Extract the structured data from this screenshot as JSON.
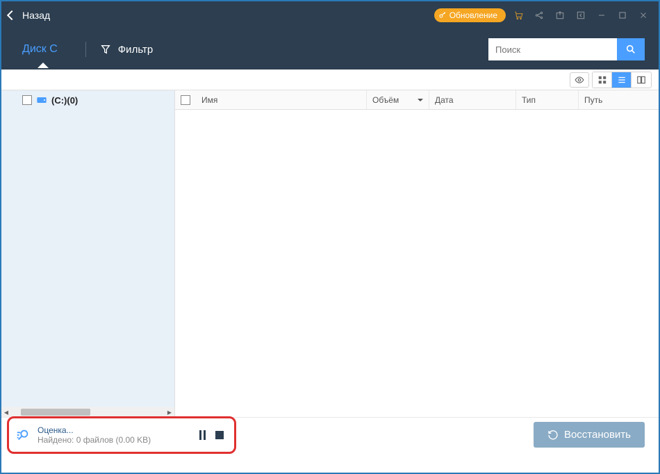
{
  "titlebar": {
    "back_label": "Назад",
    "update_label": "Обновление"
  },
  "toolbar": {
    "tab_label": "Диск С",
    "filter_label": "Фильтр",
    "search_placeholder": "Поиск"
  },
  "sidebar": {
    "tree_item": "(C:)(0)"
  },
  "columns": {
    "name": "Имя",
    "size": "Объём",
    "date": "Дата",
    "type": "Тип",
    "path": "Путь"
  },
  "footer": {
    "scan_title": "Оценка...",
    "scan_subtitle": "Найдено: 0 файлов (0.00 KB)",
    "restore_label": "Восстановить"
  }
}
